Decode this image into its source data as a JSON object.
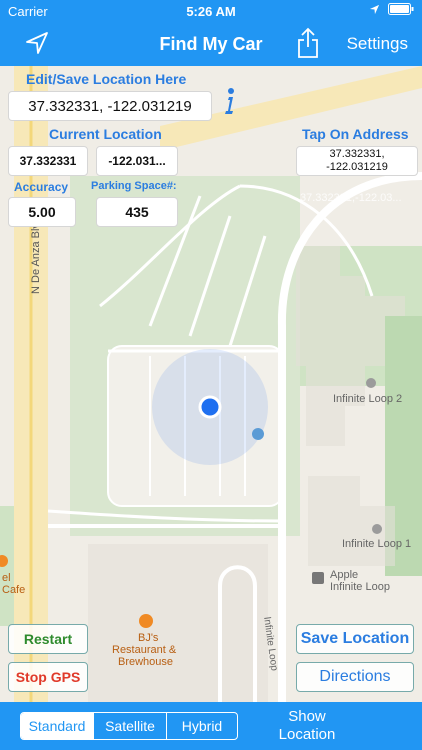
{
  "status": {
    "carrier": "Carrier",
    "time": "5:26 AM"
  },
  "nav": {
    "title": "Find My Car",
    "settings": "Settings"
  },
  "edit": {
    "label": "Edit/Save Location Here",
    "value": "37.332331, -122.031219"
  },
  "current": {
    "label": "Current Location",
    "lat": "37.332331",
    "lon": "-122.031..."
  },
  "tap": {
    "label": "Tap On Address",
    "value": "37.332331,\n-122.031219"
  },
  "accuracy": {
    "label": "Accuracy",
    "value": "5.00"
  },
  "parking": {
    "label": "Parking Space#:",
    "value": "435"
  },
  "map_labels": {
    "street": "N De Anza Blvd",
    "infinite_loop_2": "Infinite Loop 2",
    "infinite_loop_1": "Infinite Loop 1",
    "apple_line1": "Apple",
    "apple_line2": "Infinite Loop",
    "bjs_line1": "BJ's",
    "bjs_line2": "Restaurant &",
    "bjs_line3": "Brewhouse",
    "infinite_loop_road": "Infinite Loop",
    "hotel_line1": "el",
    "hotel_line2": "Cafe",
    "ghost_coords": "37.332331,-122.03..."
  },
  "buttons": {
    "restart": "Restart",
    "stop_gps": "Stop GPS",
    "save_location": "Save Location",
    "directions": "Directions"
  },
  "bottom": {
    "segments": [
      "Standard",
      "Satellite",
      "Hybrid"
    ],
    "show_location": "Show Location"
  },
  "colors": {
    "accent": "#2196f3",
    "label": "#2b7de0",
    "restart": "#2e8b2e",
    "stop": "#e03a2a",
    "user_dot": "#1e6ff0"
  }
}
